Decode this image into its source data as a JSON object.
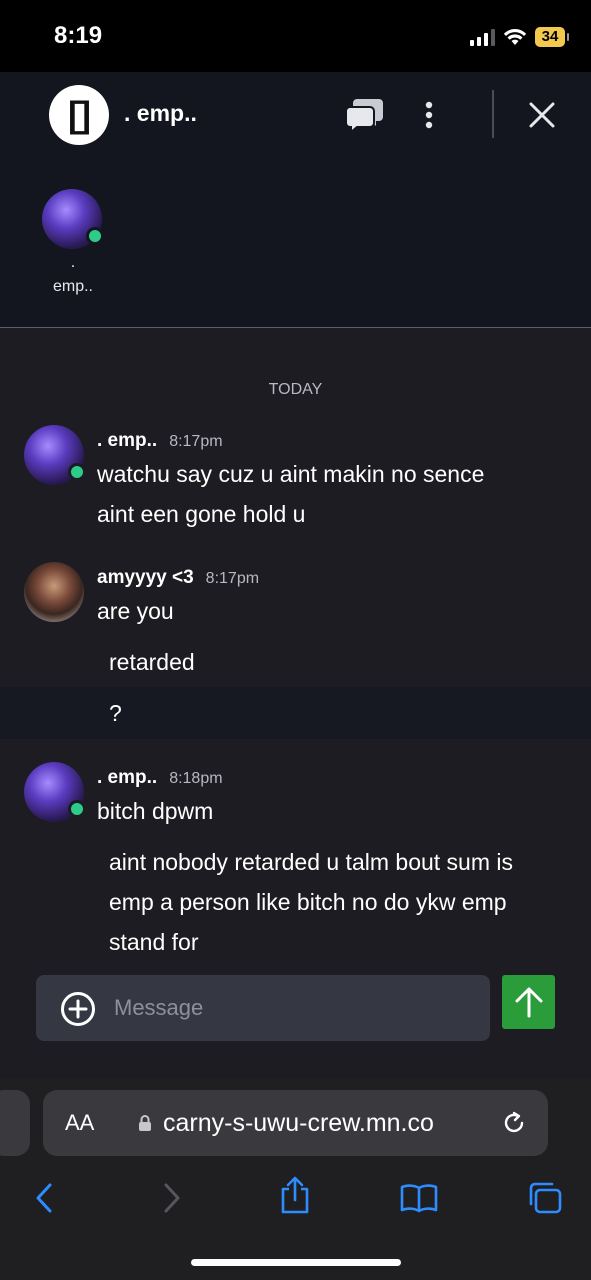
{
  "status_bar": {
    "time": "8:19",
    "battery": "34"
  },
  "header": {
    "group_avatar_text": "[]",
    "title": ". emp..",
    "member": {
      "name_line1": ".",
      "name_line2": "emp.."
    }
  },
  "chat": {
    "day_label": "TODAY",
    "messages": [
      {
        "author": ". emp..",
        "time": "8:17pm",
        "lines": [
          "watchu say cuz u aint makin no sence",
          "aint een gone hold u"
        ]
      },
      {
        "author": "amyyyy <3",
        "time": "8:17pm",
        "lines": [
          "are you"
        ],
        "followups": [
          "retarded",
          "?"
        ]
      },
      {
        "author": ". emp..",
        "time": "8:18pm",
        "lines": [
          "bitch dpwm"
        ],
        "followups": [
          "aint nobody retarded u talm bout sum is",
          "emp a person like bitch no do ykw emp",
          "stand for"
        ]
      }
    ]
  },
  "composer": {
    "placeholder": "Message"
  },
  "browser": {
    "aa_label": "AA",
    "url": "carny-s-uwu-crew.mn.co"
  },
  "colors": {
    "online": "#2ecc8a",
    "send_button": "#2a9d3a",
    "battery": "#f2c94c",
    "ios_blue": "#2f8cff"
  }
}
